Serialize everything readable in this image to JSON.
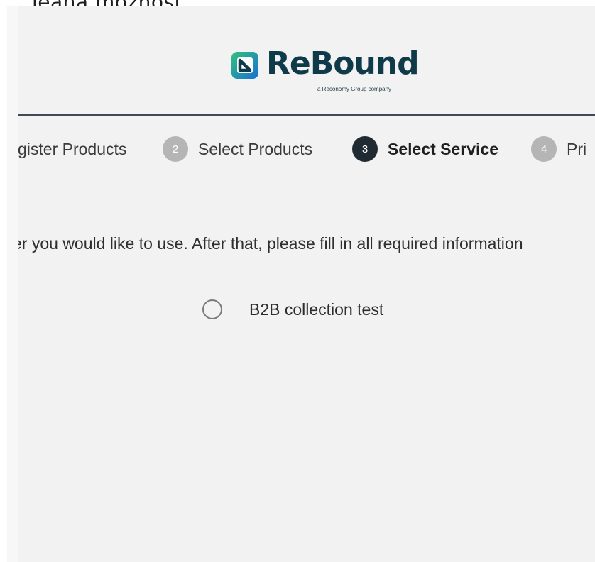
{
  "top_text": "jeana mozhost.",
  "logo": {
    "word": "ReBound",
    "tagline": "a Reconomy Group company",
    "colors": {
      "green": "#2fb36b",
      "blue": "#1f6fd1",
      "dark": "#0f3a4a"
    }
  },
  "stepper": {
    "steps": [
      {
        "label": "gister Products",
        "number": "",
        "state": "completed"
      },
      {
        "label": "Select Products",
        "number": "2",
        "state": "completed"
      },
      {
        "label": "Select Service",
        "number": "3",
        "state": "active"
      },
      {
        "label": "Pri",
        "number": "4",
        "state": "pending"
      }
    ]
  },
  "instruction": "er you would like to use. After that, please fill in all required information",
  "options": [
    {
      "label": "B2B collection test",
      "selected": false
    }
  ]
}
